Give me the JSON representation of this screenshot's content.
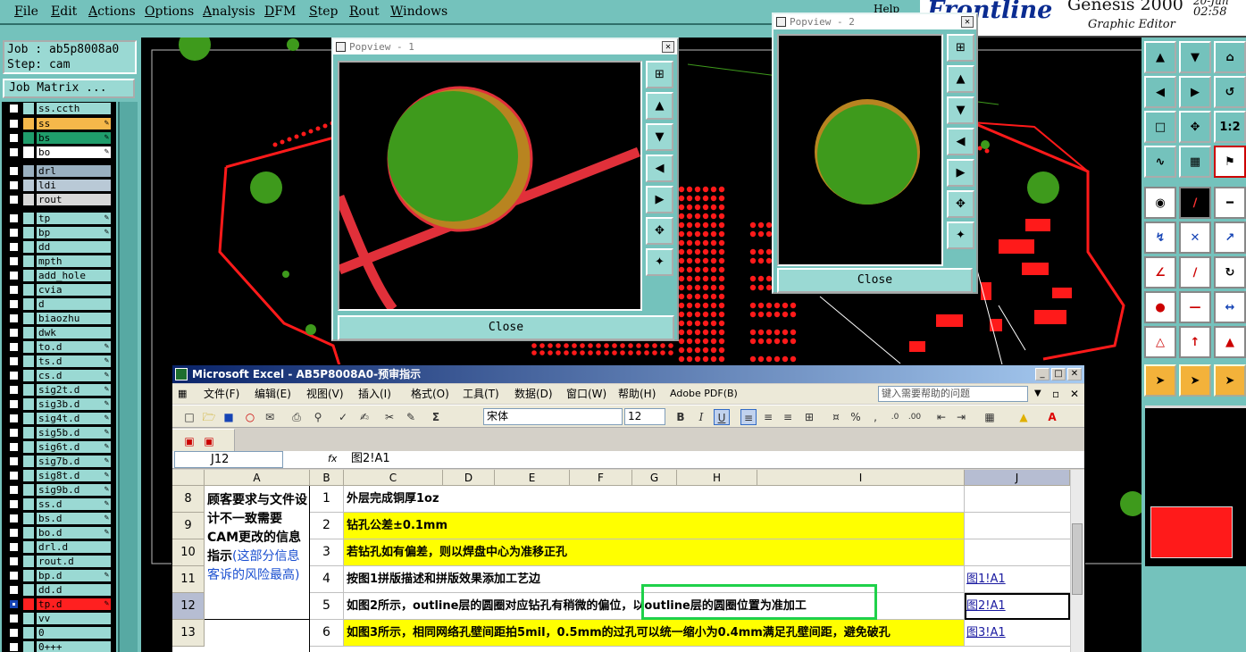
{
  "menubar": {
    "items": [
      "File",
      "Edit",
      "Actions",
      "Options",
      "Analysis",
      "DFM",
      "Step",
      "Rout",
      "Windows"
    ],
    "help": "Help"
  },
  "brand": {
    "logo": "Frontline",
    "product": "Genesis 2000",
    "subtitle": "Graphic Editor",
    "date": "20-Jun",
    "time": "02:58"
  },
  "job": {
    "job_line": "Job : ab5p8008a0",
    "step_line": "Step: cam",
    "matrix_button": "Job Matrix ..."
  },
  "layers": [
    {
      "name": "ss.ccth",
      "color": "#9ad9d3",
      "checked": false,
      "mark": ""
    },
    {
      "name": "ss",
      "color": "#f5b84a",
      "checked": false,
      "mark": "✎"
    },
    {
      "name": "bs",
      "color": "#1f9d6b",
      "checked": false,
      "mark": "✎"
    },
    {
      "name": "bo",
      "color": "#ffffff",
      "checked": false,
      "mark": "✎"
    },
    {
      "name": "drl",
      "color": "#9ab0c0",
      "checked": false,
      "mark": ""
    },
    {
      "name": "ldi",
      "color": "#b9c9d6",
      "checked": false,
      "mark": ""
    },
    {
      "name": "rout",
      "color": "#d8d8d8",
      "checked": false,
      "mark": ""
    },
    {
      "name": "tp",
      "color": "#9ad9d3",
      "checked": false,
      "mark": "✎"
    },
    {
      "name": "bp",
      "color": "#9ad9d3",
      "checked": false,
      "mark": "✎"
    },
    {
      "name": "dd",
      "color": "#9ad9d3",
      "checked": false,
      "mark": ""
    },
    {
      "name": "mpth",
      "color": "#9ad9d3",
      "checked": false,
      "mark": ""
    },
    {
      "name": "add_hole",
      "color": "#9ad9d3",
      "checked": false,
      "mark": ""
    },
    {
      "name": "cvia",
      "color": "#9ad9d3",
      "checked": false,
      "mark": ""
    },
    {
      "name": "d",
      "color": "#9ad9d3",
      "checked": false,
      "mark": ""
    },
    {
      "name": "biaozhu",
      "color": "#9ad9d3",
      "checked": false,
      "mark": ""
    },
    {
      "name": "dwk",
      "color": "#9ad9d3",
      "checked": false,
      "mark": ""
    },
    {
      "name": "to.d",
      "color": "#9ad9d3",
      "checked": false,
      "mark": "✎"
    },
    {
      "name": "ts.d",
      "color": "#9ad9d3",
      "checked": false,
      "mark": "✎"
    },
    {
      "name": "cs.d",
      "color": "#9ad9d3",
      "checked": false,
      "mark": "✎"
    },
    {
      "name": "sig2t.d",
      "color": "#9ad9d3",
      "checked": false,
      "mark": "✎"
    },
    {
      "name": "sig3b.d",
      "color": "#9ad9d3",
      "checked": false,
      "mark": "✎"
    },
    {
      "name": "sig4t.d",
      "color": "#9ad9d3",
      "checked": false,
      "mark": "✎"
    },
    {
      "name": "sig5b.d",
      "color": "#9ad9d3",
      "checked": false,
      "mark": "✎"
    },
    {
      "name": "sig6t.d",
      "color": "#9ad9d3",
      "checked": false,
      "mark": "✎"
    },
    {
      "name": "sig7b.d",
      "color": "#9ad9d3",
      "checked": false,
      "mark": "✎"
    },
    {
      "name": "sig8t.d",
      "color": "#9ad9d3",
      "checked": false,
      "mark": "✎"
    },
    {
      "name": "sig9b.d",
      "color": "#9ad9d3",
      "checked": false,
      "mark": "✎"
    },
    {
      "name": "ss.d",
      "color": "#9ad9d3",
      "checked": false,
      "mark": "✎"
    },
    {
      "name": "bs.d",
      "color": "#9ad9d3",
      "checked": false,
      "mark": "✎"
    },
    {
      "name": "bo.d",
      "color": "#9ad9d3",
      "checked": false,
      "mark": "✎"
    },
    {
      "name": "drl.d",
      "color": "#9ad9d3",
      "checked": false,
      "mark": ""
    },
    {
      "name": "rout.d",
      "color": "#9ad9d3",
      "checked": false,
      "mark": ""
    },
    {
      "name": "bp.d",
      "color": "#9ad9d3",
      "checked": false,
      "mark": "✎"
    },
    {
      "name": "dd.d",
      "color": "#9ad9d3",
      "checked": false,
      "mark": ""
    },
    {
      "name": "tp.d",
      "color": "#ff2020",
      "checked": true,
      "mark": "✎"
    },
    {
      "name": "vv",
      "color": "#9ad9d3",
      "checked": false,
      "mark": ""
    },
    {
      "name": "0",
      "color": "#9ad9d3",
      "checked": false,
      "mark": ""
    },
    {
      "name": "0+++",
      "color": "#9ad9d3",
      "checked": false,
      "mark": ""
    }
  ],
  "popview1": {
    "title": "Popview - 1",
    "close": "Close"
  },
  "popview2": {
    "title": "Popview - 2",
    "close": "Close"
  },
  "excel": {
    "title": "Microsoft Excel - AB5P8008A0-预审指示",
    "menu": [
      "文件(F)",
      "编辑(E)",
      "视图(V)",
      "插入(I)",
      "格式(O)",
      "工具(T)",
      "数据(D)",
      "窗口(W)",
      "帮助(H)",
      "Adobe PDF(B)"
    ],
    "ask": "键入需要帮助的问题",
    "font": "宋体",
    "font_size": "12",
    "name_box": "J12",
    "fx": "fx",
    "formula": "图2!A1",
    "columns": [
      "A",
      "B",
      "C",
      "D",
      "E",
      "F",
      "G",
      "H",
      "I",
      "J"
    ],
    "merged_a": {
      "black": "顾客要求与文件设计不一致需要CAM更改的信息指示",
      "blue": "(这部分信息客诉的风险最高)"
    },
    "rows": [
      {
        "num": "8",
        "b": "1",
        "c": "外层完成铜厚1oz",
        "j": "",
        "yellow": false
      },
      {
        "num": "9",
        "b": "2",
        "c": "钻孔公差±0.1mm",
        "j": "",
        "yellow": true
      },
      {
        "num": "10",
        "b": "3",
        "c": "若钻孔如有偏差，则以焊盘中心为准移正孔",
        "j": "",
        "yellow": true
      },
      {
        "num": "11",
        "b": "4",
        "c": "按图1拼版描述和拼版效果添加工艺边",
        "j": "图1!A1",
        "yellow": false
      },
      {
        "num": "12",
        "b": "5",
        "c": "如图2所示，outline层的圆圈对应钻孔有稍微的偏位，以outline层的圆圈位置为准加工",
        "j": "图2!A1",
        "yellow": false
      },
      {
        "num": "13",
        "b": "6",
        "c": "如图3所示，相同网络孔壁间距拍5mil，0.5mm的过孔可以统一缩小为0.4mm满足孔壁间距，避免破孔",
        "j": "图3!A1",
        "yellow": true
      }
    ]
  },
  "colors": {
    "panel": "#74c2bc",
    "canvas": "#000000",
    "trace": "#ff1a1a",
    "pad": "#3e9a1c",
    "highlight": "#1fd14a"
  }
}
